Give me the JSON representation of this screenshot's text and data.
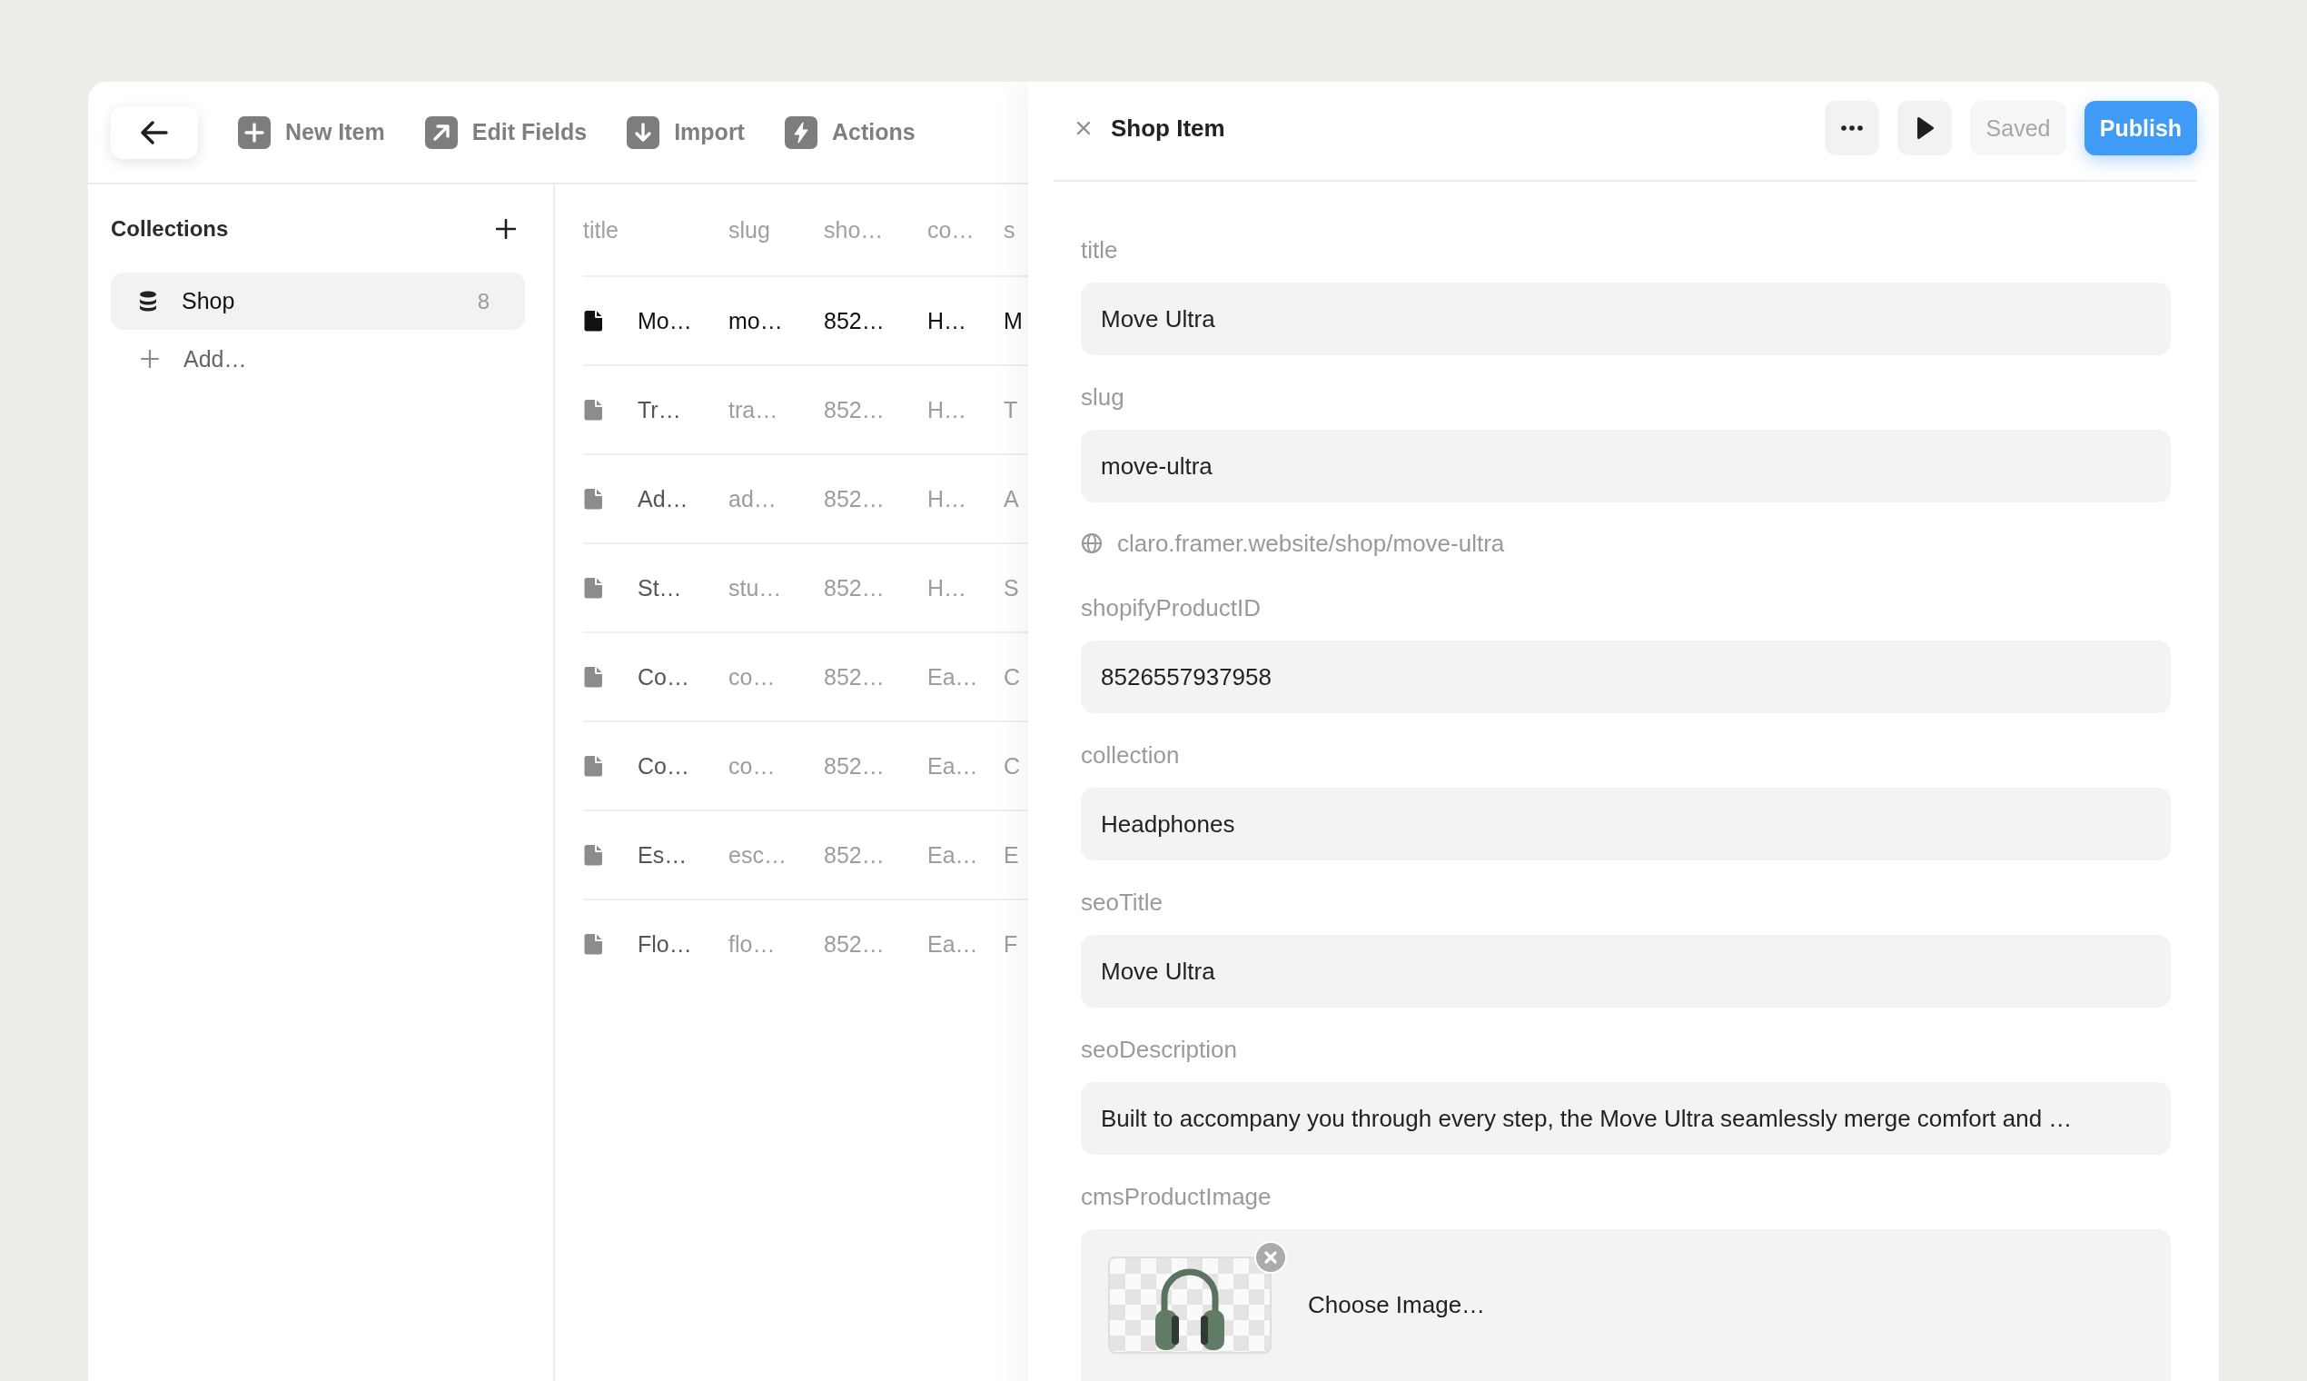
{
  "toolbar": {
    "actions": [
      {
        "kind": "add",
        "label": "New Item"
      },
      {
        "kind": "edit",
        "label": "Edit Fields"
      },
      {
        "kind": "import",
        "label": "Import"
      },
      {
        "kind": "actions",
        "label": "Actions"
      }
    ]
  },
  "sidebar": {
    "title": "Collections",
    "collections": [
      {
        "name": "Shop",
        "count": "8",
        "selected": true
      }
    ],
    "add_label": "Add…"
  },
  "table": {
    "columns": [
      "title",
      "slug",
      "sho…",
      "co…",
      "s"
    ],
    "rows": [
      {
        "selected": true,
        "cells": [
          "Mo…",
          "mo…",
          "852…",
          "H…",
          "M"
        ]
      },
      {
        "selected": false,
        "cells": [
          "Tr…",
          "tra…",
          "852…",
          "H…",
          "T"
        ]
      },
      {
        "selected": false,
        "cells": [
          "Ad…",
          "ad…",
          "852…",
          "H…",
          "A"
        ]
      },
      {
        "selected": false,
        "cells": [
          "St…",
          "stu…",
          "852…",
          "H…",
          "S"
        ]
      },
      {
        "selected": false,
        "cells": [
          "Co…",
          "co…",
          "852…",
          "Ea…",
          "C"
        ]
      },
      {
        "selected": false,
        "cells": [
          "Co…",
          "co…",
          "852…",
          "Ea…",
          "C"
        ]
      },
      {
        "selected": false,
        "cells": [
          "Es…",
          "esc…",
          "852…",
          "Ea…",
          "E"
        ]
      },
      {
        "selected": false,
        "cells": [
          "Flo…",
          "flo…",
          "852…",
          "Ea…",
          "F"
        ]
      }
    ]
  },
  "panel": {
    "title": "Shop Item",
    "buttons": [
      {
        "kind": "more"
      },
      {
        "kind": "preview"
      },
      {
        "kind": "status",
        "label": "Saved",
        "disabled": true
      },
      {
        "kind": "primary",
        "label": "Publish"
      }
    ],
    "fields": [
      {
        "kind": "text",
        "label": "title",
        "value": "Move Ultra"
      },
      {
        "kind": "text",
        "label": "slug",
        "value": "move-ultra",
        "url": "claro.framer.website/shop/move-ultra"
      },
      {
        "kind": "text",
        "label": "shopifyProductID",
        "value": "8526557937958"
      },
      {
        "kind": "text",
        "label": "collection",
        "value": "Headphones"
      },
      {
        "kind": "text",
        "label": "seoTitle",
        "value": "Move Ultra"
      },
      {
        "kind": "text",
        "label": "seoDescription",
        "value": "Built to accompany you through every step, the Move Ultra seamlessly merge comfort and …"
      },
      {
        "kind": "image",
        "label": "cmsProductImage",
        "button": "Choose Image…"
      }
    ]
  }
}
